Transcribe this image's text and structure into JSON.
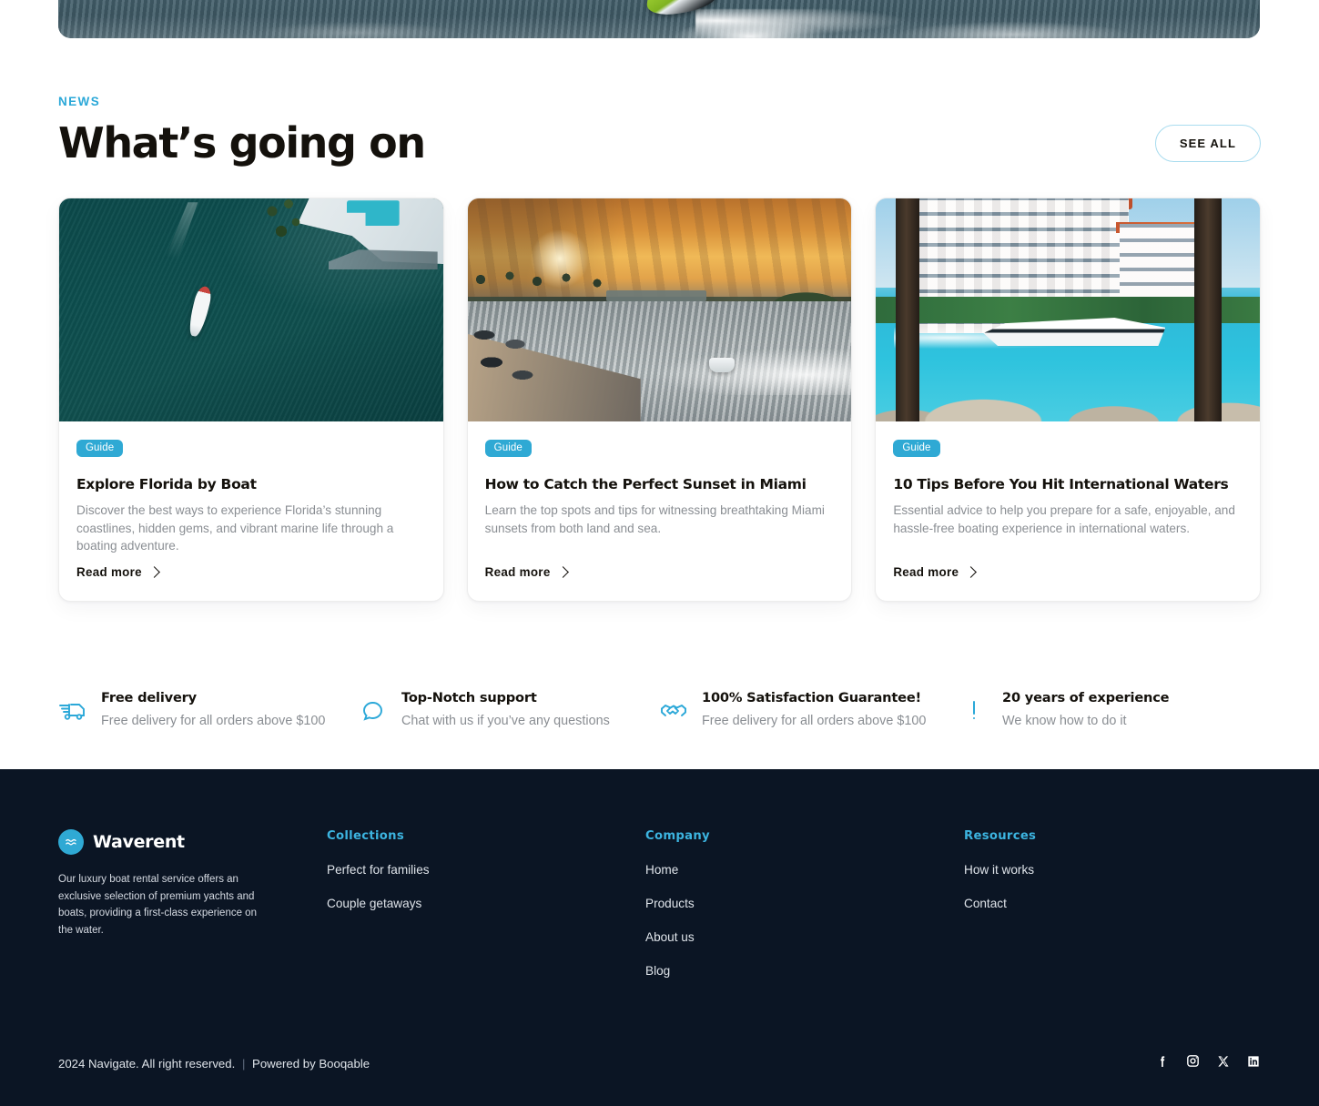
{
  "hero": {
    "alt": "jet-ski-on-water-banner"
  },
  "news": {
    "eyebrow": "NEWS",
    "title": "What’s going on",
    "see_all_label": "SEE ALL",
    "cards": [
      {
        "badge": "Guide",
        "title": "Explore Florida by Boat",
        "desc": "Discover the best ways to experience Florida’s stunning coastlines, hidden gems, and vibrant marine life through a boating adventure.",
        "cta": "Read more",
        "image_alt": "aerial-view-boat-teal-water"
      },
      {
        "badge": "Guide",
        "title": "How to Catch the Perfect Sunset in Miami",
        "desc": "Learn the top spots and tips for witnessing breathtaking Miami sunsets from both land and sea.",
        "cta": "Read more",
        "image_alt": "golden-sunset-canal-boat"
      },
      {
        "badge": "Guide",
        "title": "10 Tips Before You Hit International Waters",
        "desc": "Essential advice to help you prepare for a safe, enjoyable, and hassle-free boating experience in international waters.",
        "cta": "Read more",
        "image_alt": "white-yacht-turquoise-water-condo"
      }
    ]
  },
  "features": [
    {
      "icon": "delivery-truck-icon",
      "title": "Free delivery",
      "sub": "Free delivery for all orders above $100"
    },
    {
      "icon": "chat-bubble-icon",
      "title": "Top-Notch support",
      "sub": "Chat with us if you’ve any questions"
    },
    {
      "icon": "handshake-icon",
      "title": "100% Satisfaction Guarantee!",
      "sub": "Free delivery for all orders above $100"
    },
    {
      "icon": "exclamation-badge-icon",
      "title": "20 years of experience",
      "sub": "We know how to do it"
    }
  ],
  "footer": {
    "brand_name": "Waverent",
    "brand_logo_icon": "wave-circle-logo-icon",
    "brand_desc": "Our luxury boat rental service offers an exclusive selection of premium yachts and boats, providing a first-class experience on the water.",
    "columns": [
      {
        "head": "Collections",
        "links": [
          "Perfect for families",
          "Couple getaways"
        ]
      },
      {
        "head": "Company",
        "links": [
          "Home",
          "Products",
          "About us",
          "Blog"
        ]
      },
      {
        "head": "Resources",
        "links": [
          "How it works",
          "Contact"
        ]
      }
    ],
    "copyright": "2024 Navigate. All right reserved.",
    "separator": "|",
    "powered_by": "Powered by Booqable",
    "socials": [
      {
        "name": "facebook-icon"
      },
      {
        "name": "instagram-icon"
      },
      {
        "name": "x-twitter-icon"
      },
      {
        "name": "linkedin-icon"
      }
    ]
  },
  "colors": {
    "accent": "#2ba8d8",
    "badge": "#2fa9d4",
    "footer_bg": "#0b1524",
    "footer_head": "#3cb4e0",
    "text_dark": "#14110c",
    "text_muted": "#8a8e93"
  }
}
